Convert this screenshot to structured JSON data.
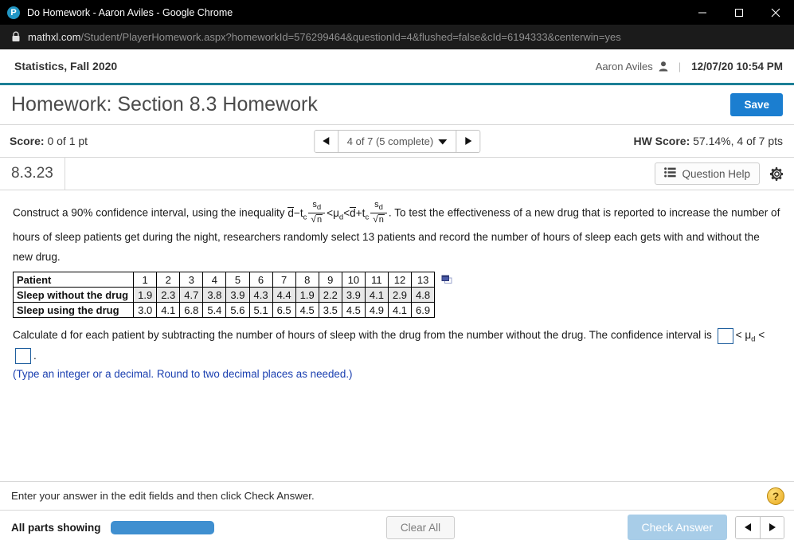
{
  "browser": {
    "title": "Do Homework - Aaron Aviles - Google Chrome",
    "logo_glyph": "P",
    "minimize_label": "Minimize",
    "maximize_label": "Maximize",
    "close_label": "Close",
    "url_host": "mathxl.com",
    "url_path": "/Student/PlayerHomework.aspx?homeworkId=576299464&questionId=4&flushed=false&cId=6194333&centerwin=yes"
  },
  "course_bar": {
    "course": "Statistics, Fall 2020",
    "user": "Aaron Aviles",
    "separator": "|",
    "timestamp": "12/07/20 10:54 PM"
  },
  "header": {
    "title": "Homework: Section 8.3 Homework",
    "save_label": "Save"
  },
  "score_bar": {
    "score_label": "Score:",
    "score_value": "0 of 1 pt",
    "nav_label": "4 of 7 (5 complete)",
    "prev_label": "Previous question",
    "next_label": "Next question",
    "hw_score_label": "HW Score:",
    "hw_score_value": "57.14%, 4 of 7 pts"
  },
  "question_bar": {
    "question_id": "8.3.23",
    "question_help_label": "Question Help",
    "settings_label": "Settings"
  },
  "question": {
    "line1_a": "Construct a 90% confidence interval, using the inequality",
    "formula": {
      "dbar": "d",
      "minus": "−",
      "plus": "+",
      "tc": "t",
      "tc_sub": "c",
      "numerator": "s",
      "numerator_sub": "d",
      "denominator": "n",
      "sqrt": "√",
      "lt": "<",
      "mu": "μ",
      "mu_sub": "d"
    },
    "line1_b": ". To test the effectiveness of a new drug that is reported to increase the number of",
    "line2": "hours of sleep patients get during the night, researchers randomly select 13 patients and record the number of hours of sleep each gets with and without the new drug.",
    "table": {
      "row_labels": [
        "Patient",
        "Sleep without the drug",
        "Sleep using the drug"
      ],
      "patients": [
        "1",
        "2",
        "3",
        "4",
        "5",
        "6",
        "7",
        "8",
        "9",
        "10",
        "11",
        "12",
        "13"
      ],
      "without_drug": [
        "1.9",
        "2.3",
        "4.7",
        "3.8",
        "3.9",
        "4.3",
        "4.4",
        "1.9",
        "2.2",
        "3.9",
        "4.1",
        "2.9",
        "4.8"
      ],
      "using_drug": [
        "3.0",
        "4.1",
        "6.8",
        "5.4",
        "5.6",
        "5.1",
        "6.5",
        "4.5",
        "3.5",
        "4.5",
        "4.9",
        "4.1",
        "6.9"
      ]
    },
    "calc_line_a": "Calculate d for each patient by subtracting the number of hours of sleep with the drug from the number without the drug. The confidence interval is",
    "answer_lower": "",
    "answer_upper": "",
    "calc_line_b": ".",
    "hint": "(Type an integer or a decimal. Round to two decimal places as needed.)"
  },
  "footer": {
    "instruction": "Enter your answer in the edit fields and then click Check Answer.",
    "help_glyph": "?",
    "parts_label": "All parts showing",
    "progress_percent": 100,
    "clear_all_label": "Clear All",
    "check_answer_label": "Check Answer",
    "prev_label": "Previous part",
    "next_label": "Next part"
  },
  "colors": {
    "accent_teal": "#1c7f96",
    "save_blue": "#1b7ed0",
    "progress_blue": "#3f8fd0",
    "check_answer_blue": "#a8cde8",
    "hint_blue": "#1a3fb0",
    "answer_box_border": "#1f5f9e"
  }
}
